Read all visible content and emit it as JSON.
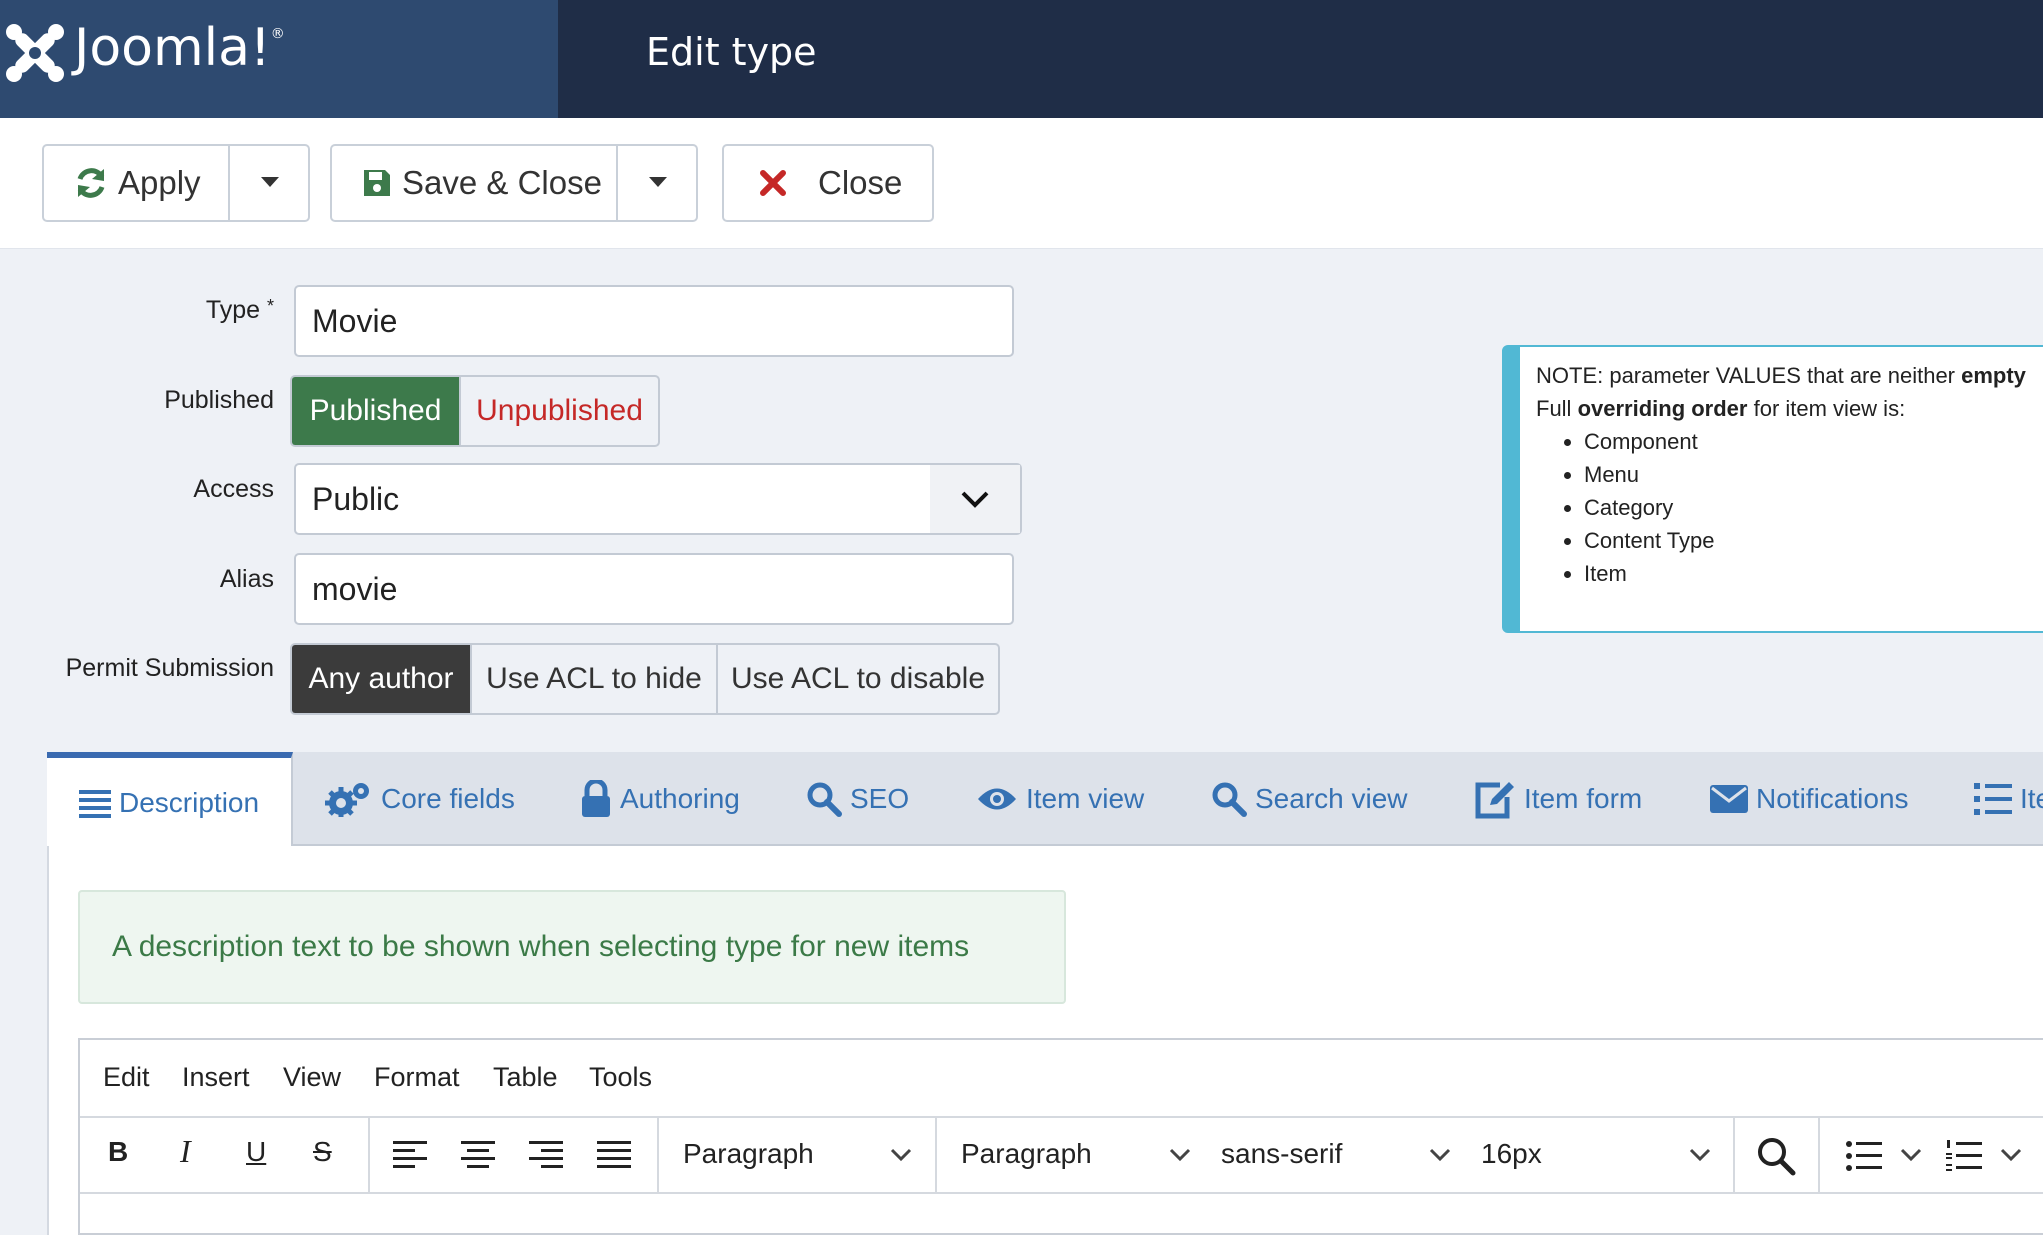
{
  "header": {
    "logo_text": "Joomla!",
    "logo_reg": "®",
    "page_title": "Edit type"
  },
  "toolbar": {
    "apply_label": "Apply",
    "save_close_label": "Save & Close",
    "close_label": "Close"
  },
  "form": {
    "type_label": "Type",
    "required_mark": "*",
    "type_value": "Movie",
    "published_label": "Published",
    "published_options": [
      "Published",
      "Unpublished"
    ],
    "published_selected": "Published",
    "access_label": "Access",
    "access_value": "Public",
    "alias_label": "Alias",
    "alias_value": "movie",
    "permit_label": "Permit Submission",
    "permit_options": [
      "Any author",
      "Use ACL to hide",
      "Use ACL to disable"
    ],
    "permit_selected": "Any author"
  },
  "note": {
    "line1_prefix": "NOTE: parameter VALUES that are neither ",
    "line1_bold": "empty",
    "line2_prefix": "Full ",
    "line2_bold": "overriding order",
    "line2_suffix": " for item view is:",
    "items": [
      "Component",
      "Menu",
      "Category",
      "Content Type",
      "Item"
    ]
  },
  "tabs": [
    "Description",
    "Core fields",
    "Authoring",
    "SEO",
    "Item view",
    "Search view",
    "Item form",
    "Notifications",
    "Ite"
  ],
  "active_tab": "Description",
  "description_hint": "A description text to be shown when selecting type for new items",
  "editor": {
    "menu": [
      "Edit",
      "Insert",
      "View",
      "Format",
      "Table",
      "Tools"
    ],
    "format_buttons": [
      "B",
      "I",
      "U",
      "S"
    ],
    "block_format": "Paragraph",
    "paragraph_select": "Paragraph",
    "font_family": "sans-serif",
    "font_size": "16px"
  },
  "colors": {
    "header_left": "#2e4a70",
    "header_right": "#1f2d47",
    "published_green": "#3d7a4b",
    "unpublished_red": "#c52827",
    "link_blue": "#3571b3",
    "note_border": "#51b8d4"
  }
}
